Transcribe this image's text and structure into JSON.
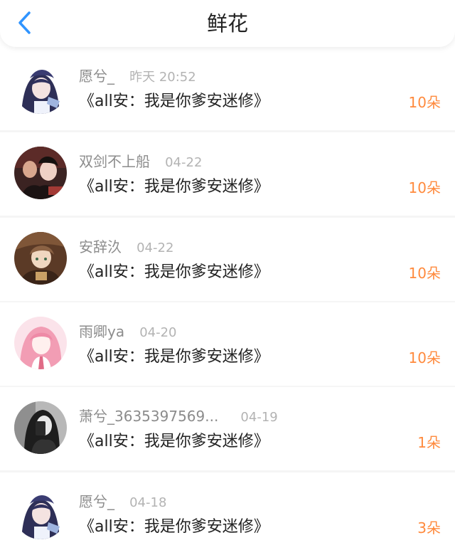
{
  "header": {
    "title": "鲜花",
    "back_icon": "chevron-left-icon",
    "accent_color": "#2f94ff"
  },
  "colors": {
    "count": "#ff8a3d",
    "name": "#8c8c8c",
    "time": "#b3b3b3"
  },
  "items": [
    {
      "name": "愿兮_",
      "time": "昨天 20:52",
      "book": "《all安：我是你爹安迷修》",
      "count": "10朵"
    },
    {
      "name": "双剑不上船",
      "time": "04-22",
      "book": "《all安：我是你爹安迷修》",
      "count": "10朵"
    },
    {
      "name": "安辞汣",
      "time": "04-22",
      "book": "《all安：我是你爹安迷修》",
      "count": "10朵"
    },
    {
      "name": "雨卿ya",
      "time": "04-20",
      "book": "《all安：我是你爹安迷修》",
      "count": "10朵"
    },
    {
      "name": "萧兮_3635397569...",
      "time": "04-19",
      "book": "《all安：我是你爹安迷修》",
      "count": "1朵"
    },
    {
      "name": "愿兮_",
      "time": "04-18",
      "book": "《all安：我是你爹安迷修》",
      "count": "3朵"
    }
  ]
}
